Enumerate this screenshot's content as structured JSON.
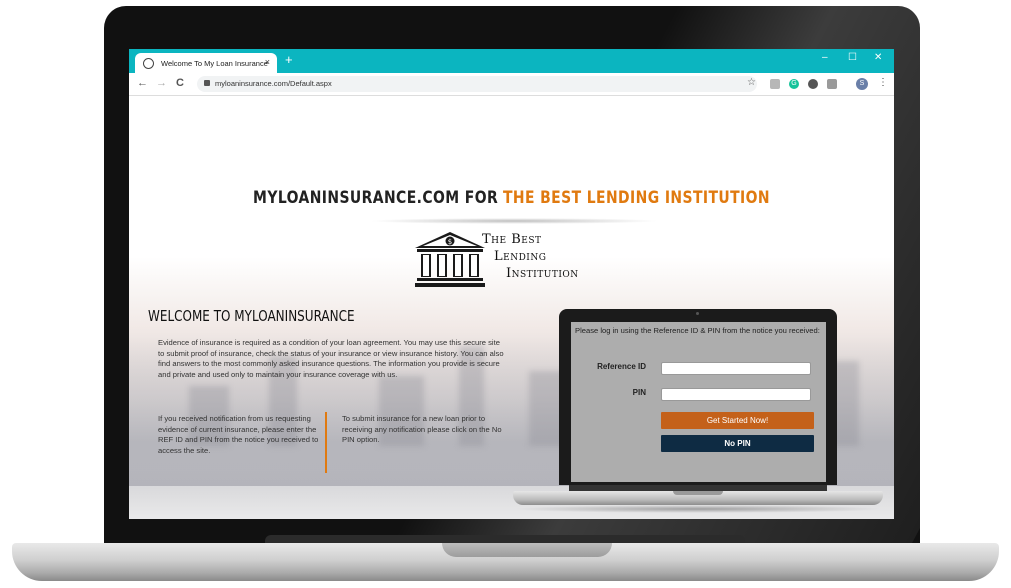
{
  "browser": {
    "tab_title": "Welcome To My Loan Insurance",
    "tab_close": "×",
    "new_tab": "+",
    "window_controls": {
      "minimize": "–",
      "maximize": "☐",
      "close": "✕"
    },
    "nav": {
      "back": "←",
      "forward": "→",
      "reload": "C"
    },
    "url": "myloaninsurance.com/Default.aspx",
    "star": "☆",
    "profile_initial": "S",
    "menu": "⋮",
    "extensions": [
      {
        "name": "ext-gray",
        "color": "#b7b7b7",
        "label": ""
      },
      {
        "name": "ext-grammarly",
        "color": "#15c39a",
        "label": "G"
      },
      {
        "name": "ext-circle",
        "color": "#555555",
        "label": ""
      },
      {
        "name": "ext-box",
        "color": "#9a9a9a",
        "label": ""
      }
    ]
  },
  "header": {
    "headline_part1": "MYLOANINSURANCE.COM FOR",
    "headline_part2": "THE BEST LENDING INSTITUTION",
    "accent_color": "#e07a10"
  },
  "logo": {
    "line1": "The Best",
    "line2": "Lending",
    "line3": "Institution",
    "symbol": "$"
  },
  "main": {
    "welcome_title": "WELCOME TO MYLOANINSURANCE",
    "intro": "Evidence of insurance is required as a condition of your loan agreement. You may use this secure site to submit proof of insurance, check the status of your insurance or view insurance history. You can also find answers to the most commonly asked insurance questions. The information you provide is secure and private and used only to maintain your insurance coverage with us.",
    "col_left": "If you received notification from us requesting evidence of current insurance, please enter the REF ID and PIN from the notice you received to access the site.",
    "col_right": "To submit insurance for a new loan prior to receiving any notification please click on the No PIN option."
  },
  "login": {
    "message": "Please log in using the Reference ID & PIN from the notice you received:",
    "reference_label": "Reference ID",
    "pin_label": "PIN",
    "reference_value": "",
    "pin_value": "",
    "get_started": "Get Started Now!",
    "no_pin": "No PIN",
    "get_started_color": "#c4611a",
    "no_pin_color": "#0e2b43"
  }
}
